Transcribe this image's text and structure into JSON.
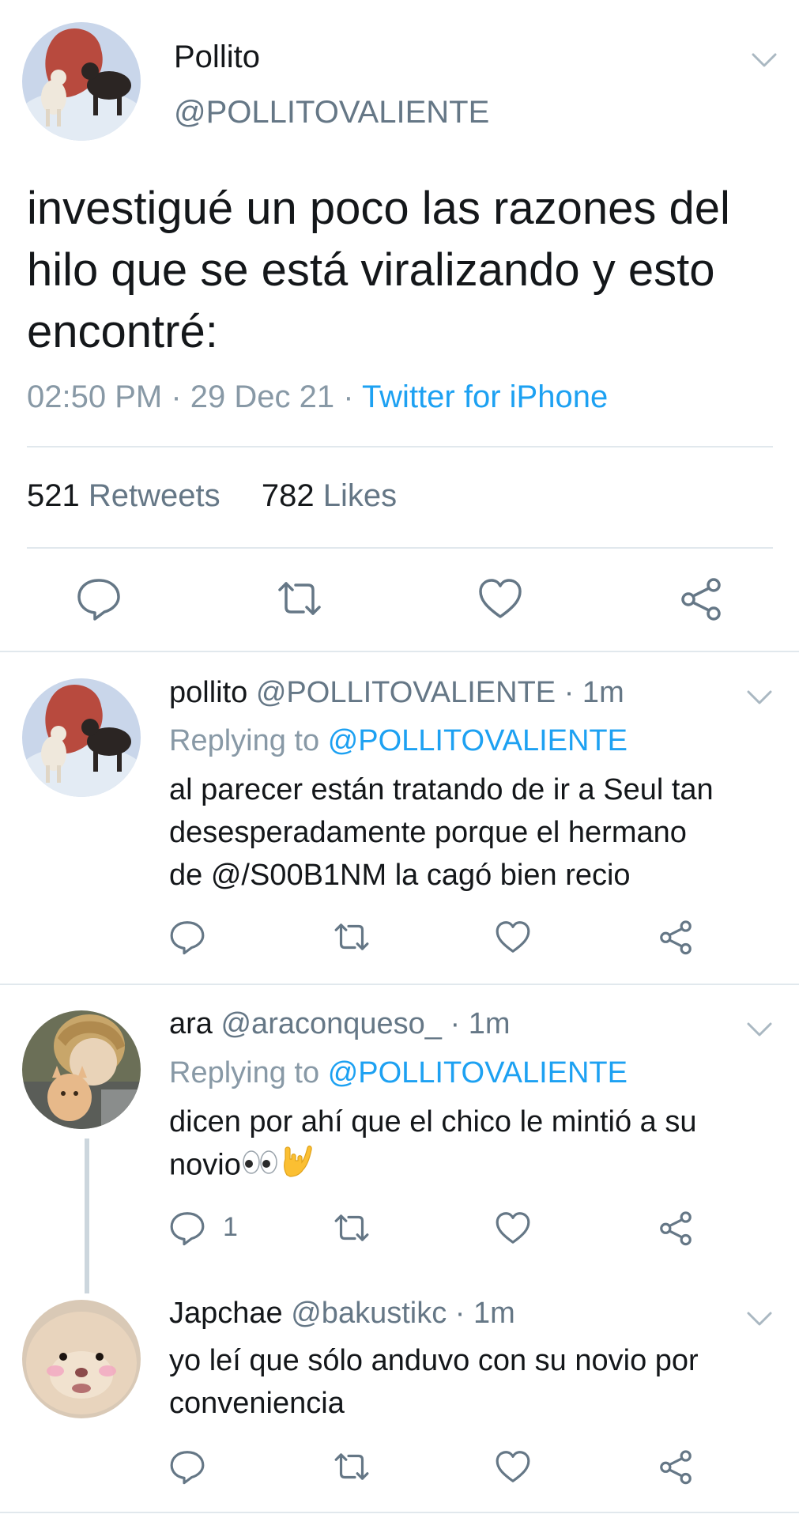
{
  "main_tweet": {
    "display_name": "Pollito",
    "handle": "@POLLITOVALIENTE",
    "text_lines": [
      "investigué un poco las razones del",
      "hilo que se está viralizando y esto",
      "encontré:"
    ],
    "time": "02:50 PM",
    "sep1": " · ",
    "date": "29 Dec 21",
    "sep2": " · ",
    "source": "Twitter for iPhone",
    "retweets_count": "521",
    "retweets_label": "Retweets",
    "likes_count": "782",
    "likes_label": "Likes",
    "actions": [
      "reply-icon",
      "retweet-icon",
      "like-icon",
      "share-icon"
    ]
  },
  "replies": [
    {
      "display_name": "pollito",
      "handle": "@POLLITOVALIENTE",
      "age": "· 1m",
      "replying_prefix": "Replying to",
      "replying_to": "@POLLITOVALIENTE",
      "text_lines": [
        "al parecer están tratando de ir a Seul tan",
        "desesperadamente porque el hermano",
        "de @/S00B1NM la cagó bien recio"
      ],
      "reply_count": ""
    },
    {
      "display_name": "ara",
      "handle": "@araconqueso_",
      "age": "· 1m",
      "replying_prefix": "Replying to",
      "replying_to": "@POLLITOVALIENTE",
      "text_lines": [
        "dicen por ahí que el chico le mintió a su",
        "novio"
      ],
      "emoji": [
        "eyes-emoji",
        "love-you-gesture-emoji"
      ],
      "reply_count": "1"
    },
    {
      "display_name": "Japchae",
      "handle": "@bakustikc",
      "age": "· 1m",
      "text_lines": [
        "yo leí que sólo anduvo con su novio por",
        "conveniencia"
      ],
      "reply_count": ""
    }
  ],
  "colors": {
    "text": "#14171a",
    "secondary": "#657786",
    "meta": "#8899a6",
    "link": "#1da1f2",
    "divider": "#e1e8ed",
    "thread_line": "#ccd6dd"
  }
}
